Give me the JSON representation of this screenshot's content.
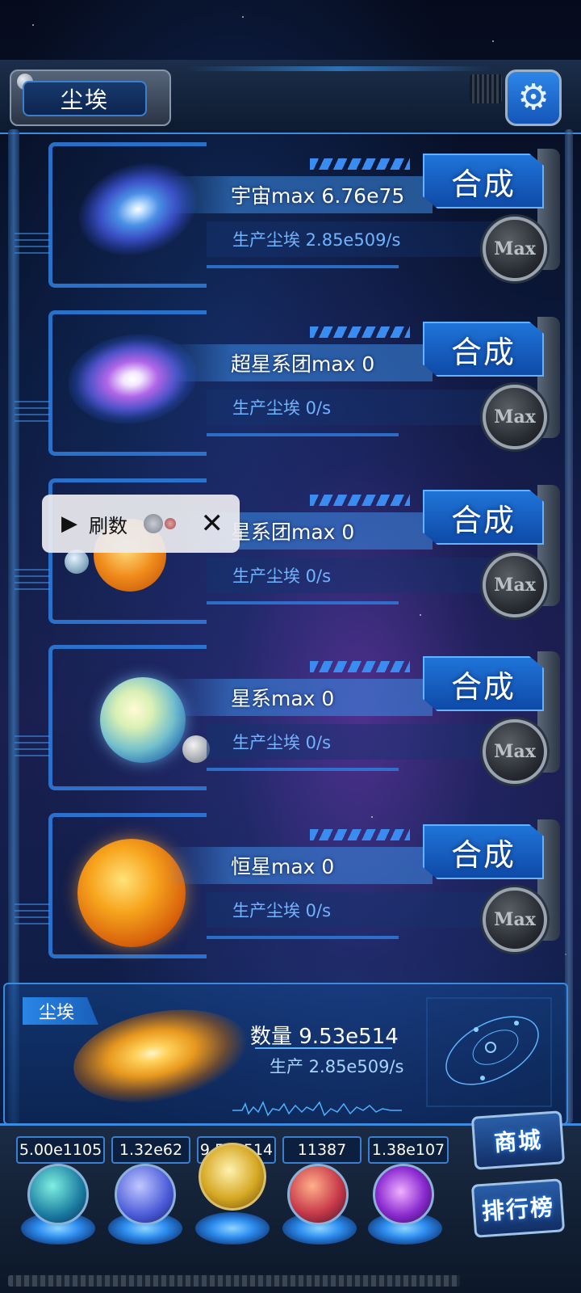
{
  "header": {
    "title": "尘埃",
    "settings_icon": "gear-icon"
  },
  "rows": [
    {
      "name": "宇宙max 6.76e75",
      "production": "生产尘埃  2.85e509/s",
      "combine_label": "合成",
      "max_label": "Max",
      "icon": "universe-image"
    },
    {
      "name": "超星系团max 0",
      "production": "生产尘埃  0/s",
      "combine_label": "合成",
      "max_label": "Max",
      "icon": "supercluster-image"
    },
    {
      "name": "星系团max 0",
      "production": "生产尘埃  0/s",
      "combine_label": "合成",
      "max_label": "Max",
      "icon": "galaxy-cluster-image"
    },
    {
      "name": "星系max 0",
      "production": "生产尘埃  0/s",
      "combine_label": "合成",
      "max_label": "Max",
      "icon": "galaxy-image"
    },
    {
      "name": "恒星max 0",
      "production": "生产尘埃  0/s",
      "combine_label": "合成",
      "max_label": "Max",
      "icon": "star-image"
    }
  ],
  "ad_overlay": {
    "label": "刷数",
    "play_icon": "play-icon",
    "close_icon": "close-icon"
  },
  "dust": {
    "tag": "尘埃",
    "count": "数量 9.53e514",
    "rate": "生产 2.85e509/s"
  },
  "resources": [
    {
      "value": "5.00e1105",
      "icon": "atom-icon"
    },
    {
      "value": "1.32e62",
      "icon": "energy-icon"
    },
    {
      "value": "9.53e514",
      "icon": "dust-icon"
    },
    {
      "value": "11387",
      "icon": "brain-icon"
    },
    {
      "value": "1.38e107",
      "icon": "void-icon"
    }
  ],
  "side_buttons": {
    "shop": "商城",
    "leaderboard": "排行榜"
  },
  "colors": {
    "accent": "#2f7fe0",
    "button_blue": "#1f74d8",
    "text_light_blue": "#6fb4ff"
  }
}
